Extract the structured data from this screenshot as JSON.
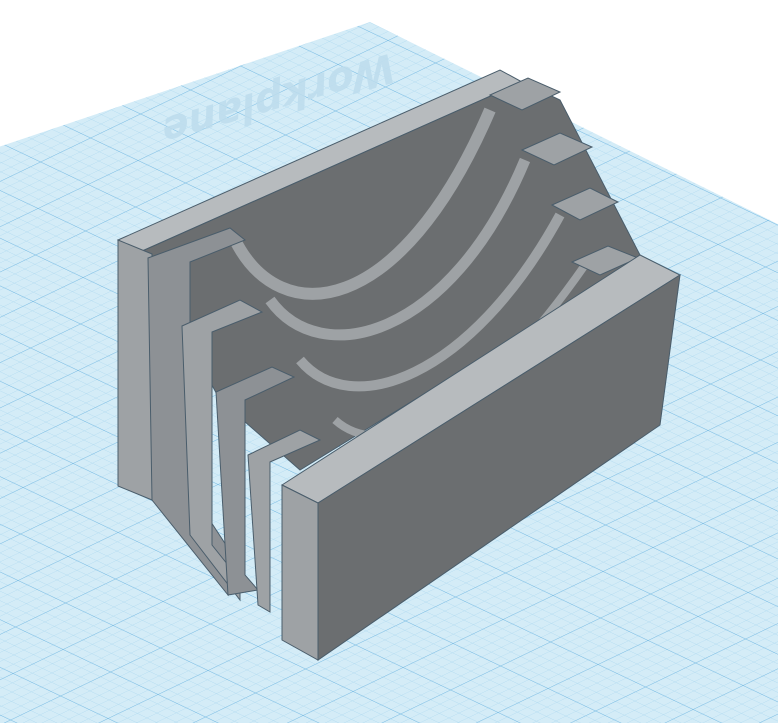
{
  "viewport": {
    "workplane_label": "Workplane",
    "workplane_color": "#d4ecf7",
    "grid_minor_color": "#a9d6ef",
    "grid_major_color": "#7dbde4"
  },
  "model": {
    "name": "tiered-card-holder",
    "slot_count": 4,
    "body_color": "#9a9ea2",
    "face_color": "#6b6e70",
    "edge_color": "#4a5d6b"
  }
}
